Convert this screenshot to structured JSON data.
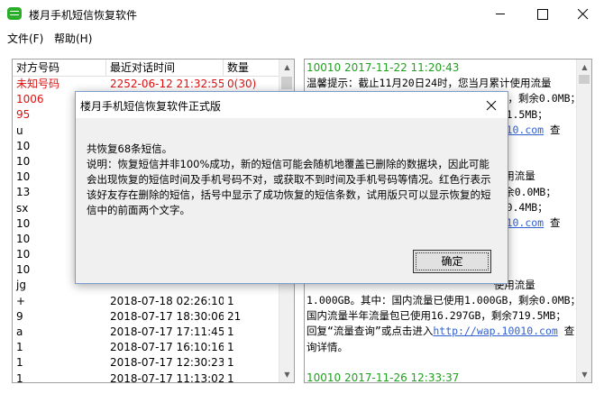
{
  "window": {
    "title": "楼月手机短信恢复软件",
    "accent_color": "#2aae2a"
  },
  "menu": {
    "items": [
      {
        "label": "文件(F)"
      },
      {
        "label": "帮助(H)"
      }
    ]
  },
  "list": {
    "columns": [
      "对方号码",
      "最近对话时间",
      "数量"
    ],
    "rows": [
      {
        "number": "未知号码",
        "time": "2252-06-12 21:32:55",
        "count": "0(30)",
        "highlight": true
      },
      {
        "number": "1006",
        "time": "",
        "count": "",
        "highlight": true
      },
      {
        "number": "95",
        "time": "",
        "count": "",
        "highlight": true
      },
      {
        "number": "u",
        "time": "",
        "count": ""
      },
      {
        "number": "10",
        "time": "",
        "count": ""
      },
      {
        "number": "10",
        "time": "",
        "count": ""
      },
      {
        "number": "10",
        "time": "",
        "count": ""
      },
      {
        "number": "13",
        "time": "",
        "count": ""
      },
      {
        "number": "sx",
        "time": "",
        "count": ""
      },
      {
        "number": "10",
        "time": "",
        "count": ""
      },
      {
        "number": "10",
        "time": "",
        "count": ""
      },
      {
        "number": "10",
        "time": "",
        "count": ""
      },
      {
        "number": "10",
        "time": "",
        "count": ""
      },
      {
        "number": "jg",
        "time": "",
        "count": ""
      },
      {
        "number": "+",
        "time": "2018-07-18 02:26:10",
        "count": "1"
      },
      {
        "number": "9",
        "time": "2018-07-17 18:30:06",
        "count": "21"
      },
      {
        "number": "a",
        "time": "2018-07-17 17:11:45",
        "count": "1"
      },
      {
        "number": "1",
        "time": "2018-07-17 16:10:16",
        "count": "1"
      },
      {
        "number": "1",
        "time": "2018-07-17 12:30:23",
        "count": "1"
      },
      {
        "number": "1",
        "time": "2018-07-17 11:13:02",
        "count": "1"
      },
      {
        "number": "1",
        "time": "2018-07-17 09:27:09",
        "count": "3"
      }
    ]
  },
  "messages": {
    "lines": [
      {
        "kind": "head",
        "text": "10010 2017-11-22 11:20:43"
      },
      {
        "kind": "text",
        "text": "温馨提示：截止11月20日24时，您当月累计使用流量"
      },
      {
        "kind": "text",
        "text": "1.000GB。其中：国内流量已使用1.000GB，剩余0.0MB；"
      },
      {
        "kind": "text",
        "text": "                              881.5MB；"
      },
      {
        "kind": "link",
        "text": "                              0010.com",
        "after": " 查"
      },
      {
        "kind": "gap",
        "text": ""
      },
      {
        "kind": "gap",
        "text": ""
      },
      {
        "kind": "text",
        "text": "                              使用流量"
      },
      {
        "kind": "text",
        "text": "                              剩余0.0MB；"
      },
      {
        "kind": "text",
        "text": "                              760.4MB；"
      },
      {
        "kind": "link",
        "text": "                              0010.com",
        "after": " 查"
      },
      {
        "kind": "gap",
        "text": ""
      },
      {
        "kind": "gap",
        "text": ""
      },
      {
        "kind": "gap",
        "text": ""
      },
      {
        "kind": "text",
        "text": "                              使用流量"
      },
      {
        "kind": "text",
        "text": "1.000GB。其中：国内流量已使用1.000GB，剩余0.0MB；"
      },
      {
        "kind": "text",
        "text": "国内流量半年流量包已使用16.297GB，剩余719.5MB；"
      },
      {
        "kind": "link",
        "pre": "回复“流量查询”或点击进入",
        "text": "http://wap.10010.com",
        "after": " 查"
      },
      {
        "kind": "text",
        "text": "询详情。"
      },
      {
        "kind": "gap",
        "text": ""
      },
      {
        "kind": "head",
        "text": "10010 2017-11-26 12:33:37"
      },
      {
        "kind": "text",
        "text": "温馨提示：截止11月24日24时，您当月累计使用流量"
      }
    ]
  },
  "dialog": {
    "title": "楼月手机短信恢复软件正式版",
    "summary": "共恢复68条短信。",
    "note_lines": [
      "说明：恢复短信并非100%成功，新的短信可能会随机地覆盖已删除的数据块，因此可能",
      "会出现恢复的短信时间及手机号码不对，或获取不到时间及手机号码等情况。红色行表示",
      "该好友存在删除的短信，括号中显示了成功恢复的短信条数，试用版只可以显示恢复的短",
      "信中的前面两个文字。"
    ],
    "ok_label": "确定"
  }
}
